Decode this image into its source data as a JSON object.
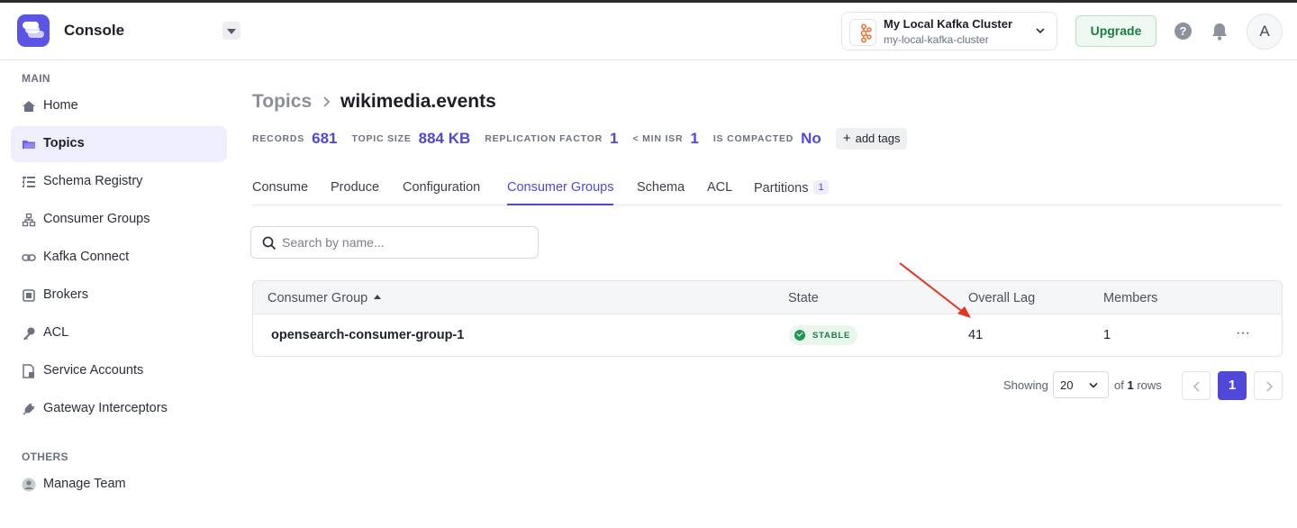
{
  "header": {
    "app_title": "Console",
    "cluster": {
      "name": "My Local Kafka Cluster",
      "id": "my-local-kafka-cluster"
    },
    "upgrade_label": "Upgrade",
    "help_label": "?",
    "avatar_initial": "A"
  },
  "sidebar": {
    "main_label": "MAIN",
    "others_label": "OTHERS",
    "items": [
      {
        "label": "Home",
        "icon": "home-icon"
      },
      {
        "label": "Topics",
        "icon": "folder-icon",
        "active": true
      },
      {
        "label": "Schema Registry",
        "icon": "schema-icon"
      },
      {
        "label": "Consumer Groups",
        "icon": "consumer-groups-icon"
      },
      {
        "label": "Kafka Connect",
        "icon": "link-icon"
      },
      {
        "label": "Brokers",
        "icon": "broker-icon"
      },
      {
        "label": "ACL",
        "icon": "key-icon"
      },
      {
        "label": "Service Accounts",
        "icon": "service-account-icon"
      },
      {
        "label": "Gateway Interceptors",
        "icon": "plug-icon"
      }
    ],
    "others_items": [
      {
        "label": "Manage Team",
        "icon": "user-icon"
      }
    ]
  },
  "breadcrumb": {
    "parent": "Topics",
    "current": "wikimedia.events"
  },
  "stats": {
    "records_label": "RECORDS",
    "records_value": "681",
    "size_label": "TOPIC SIZE",
    "size_value": "884 KB",
    "replication_label": "REPLICATION FACTOR",
    "replication_value": "1",
    "min_isr_label": "< MIN ISR",
    "min_isr_value": "1",
    "compacted_label": "IS COMPACTED",
    "compacted_value": "No",
    "add_tags_label": "add tags"
  },
  "tabs": [
    {
      "label": "Consume"
    },
    {
      "label": "Produce"
    },
    {
      "label": "Configuration"
    },
    {
      "label": "Consumer Groups",
      "active": true
    },
    {
      "label": "Schema"
    },
    {
      "label": "ACL"
    },
    {
      "label": "Partitions",
      "badge": "1"
    }
  ],
  "search": {
    "placeholder": "Search by name..."
  },
  "table": {
    "columns": [
      "Consumer Group",
      "State",
      "Overall Lag",
      "Members"
    ],
    "rows": [
      {
        "group": "opensearch-consumer-group-1",
        "state": "STABLE",
        "lag": "41",
        "members": "1",
        "more": "···"
      }
    ]
  },
  "pagination": {
    "showing_label": "Showing",
    "page_size": "20",
    "of_label": "of",
    "total": "1",
    "rows_label": "rows",
    "current_page": "1"
  },
  "colors": {
    "accent": "#4f48d9",
    "success": "#239553",
    "annotation_arrow": "#e8321f"
  }
}
